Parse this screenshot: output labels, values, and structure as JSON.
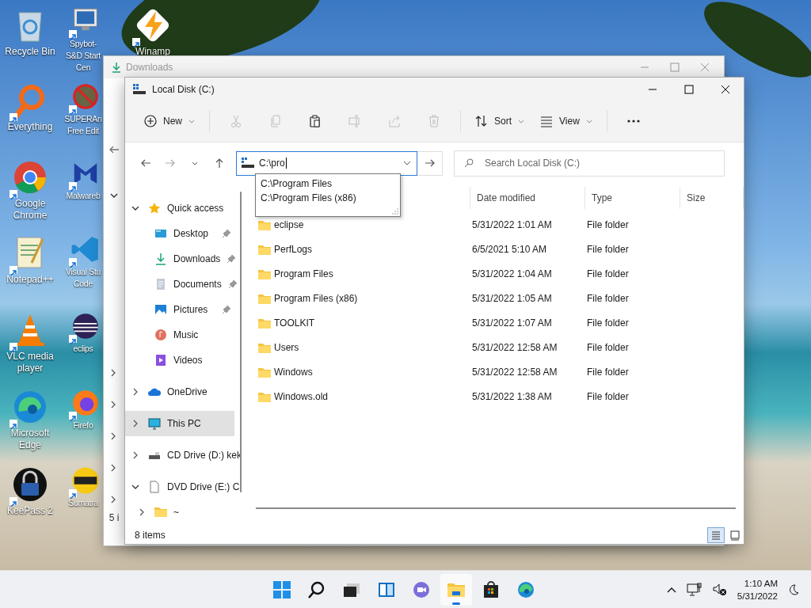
{
  "desktop_icons": [
    {
      "label": "Recycle Bin",
      "kind": "recycle"
    },
    {
      "label": "Everything",
      "kind": "magnifier"
    },
    {
      "label": "Google Chrome",
      "kind": "chrome"
    },
    {
      "label": "Notepad++",
      "kind": "notepad"
    },
    {
      "label": "VLC media player",
      "kind": "cone"
    },
    {
      "label": "Microsoft Edge",
      "kind": "edge"
    },
    {
      "label": "KeePass 2",
      "kind": "lock"
    },
    {
      "label": "Spybot-S&D Start Cen",
      "kind": "monitor"
    },
    {
      "label": "SUPERAn Free Edit",
      "kind": "nobug"
    },
    {
      "label": "Malwareb",
      "kind": "malware"
    },
    {
      "label": "Visual Stu Code",
      "kind": "vscode"
    },
    {
      "label": "eclips",
      "kind": "eclipse"
    },
    {
      "label": "Firefo",
      "kind": "firefox"
    },
    {
      "label": "Sumatra",
      "kind": "pdf"
    },
    {
      "label": "Winamp",
      "kind": "bolt"
    }
  ],
  "back_window": {
    "title": "Downloads",
    "status": "5 i"
  },
  "window": {
    "title": "Local Disk (C:)",
    "toolbar": [
      {
        "kind": "new",
        "label": "New",
        "disabled": false
      },
      {
        "kind": "cut",
        "disabled": true
      },
      {
        "kind": "copy",
        "disabled": true
      },
      {
        "kind": "paste",
        "disabled": false
      },
      {
        "kind": "rename",
        "disabled": true
      },
      {
        "kind": "share",
        "disabled": true
      },
      {
        "kind": "delete",
        "disabled": true
      },
      {
        "kind": "sort",
        "label": "Sort",
        "disabled": false
      },
      {
        "kind": "view",
        "label": "View",
        "disabled": false
      },
      {
        "kind": "more",
        "disabled": false
      }
    ],
    "address": {
      "value": "C:\\pro",
      "suggestions": [
        "C:\\Program Files",
        "C:\\Program Files (x86)"
      ]
    },
    "search": {
      "placeholder": "Search Local Disk (C:)"
    },
    "nav": [
      {
        "label": "Quick access",
        "kind": "star",
        "expanded": true,
        "selected": false,
        "children": [
          {
            "label": "Desktop",
            "kind": "desktop",
            "pinned": true,
            "selected": false
          },
          {
            "label": "Downloads",
            "kind": "download",
            "pinned": true,
            "selected": false
          },
          {
            "label": "Documents",
            "kind": "document",
            "pinned": true,
            "selected": false
          },
          {
            "label": "Pictures",
            "kind": "picture",
            "pinned": true,
            "selected": false
          },
          {
            "label": "Music",
            "kind": "music",
            "pinned": false,
            "selected": false
          },
          {
            "label": "Videos",
            "kind": "video",
            "pinned": false,
            "selected": false
          }
        ]
      },
      {
        "label": "OneDrive",
        "kind": "cloud",
        "expanded": false,
        "selected": false
      },
      {
        "label": "This PC",
        "kind": "pc",
        "expanded": false,
        "selected": true
      },
      {
        "label": "CD Drive (D:) kek",
        "kind": "drive",
        "expanded": false,
        "selected": false
      },
      {
        "label": "DVD Drive (E:) C",
        "kind": "file",
        "expanded": true,
        "selected": false,
        "children": [
          {
            "label": "~",
            "kind": "folder",
            "expanded": false,
            "selected": false
          }
        ]
      }
    ],
    "table": {
      "columns": [
        "Date modified",
        "Type",
        "Size"
      ],
      "rows": [
        {
          "name": "eclipse",
          "date": "5/31/2022 1:01 AM",
          "type": "File folder"
        },
        {
          "name": "PerfLogs",
          "date": "6/5/2021 5:10 AM",
          "type": "File folder"
        },
        {
          "name": "Program Files",
          "date": "5/31/2022 1:04 AM",
          "type": "File folder"
        },
        {
          "name": "Program Files (x86)",
          "date": "5/31/2022 1:05 AM",
          "type": "File folder"
        },
        {
          "name": "TOOLKIT",
          "date": "5/31/2022 1:07 AM",
          "type": "File folder"
        },
        {
          "name": "Users",
          "date": "5/31/2022 12:58 AM",
          "type": "File folder"
        },
        {
          "name": "Windows",
          "date": "5/31/2022 12:58 AM",
          "type": "File folder"
        },
        {
          "name": "Windows.old",
          "date": "5/31/2022 1:38 AM",
          "type": "File folder"
        }
      ]
    },
    "status_bar": {
      "count": "8 items",
      "views": [
        {
          "kind": "details",
          "selected": true
        },
        {
          "kind": "tiles",
          "selected": false
        }
      ]
    }
  },
  "taskbar": {
    "apps": [
      {
        "kind": "start",
        "active": false
      },
      {
        "kind": "search",
        "active": false
      },
      {
        "kind": "taskview",
        "active": false
      },
      {
        "kind": "widgets",
        "active": false
      },
      {
        "kind": "chat",
        "active": false
      },
      {
        "kind": "explorer",
        "active": true
      },
      {
        "kind": "store",
        "active": false
      },
      {
        "kind": "edge",
        "active": false
      }
    ],
    "time": "1:10 AM",
    "date": "5/31/2022"
  }
}
